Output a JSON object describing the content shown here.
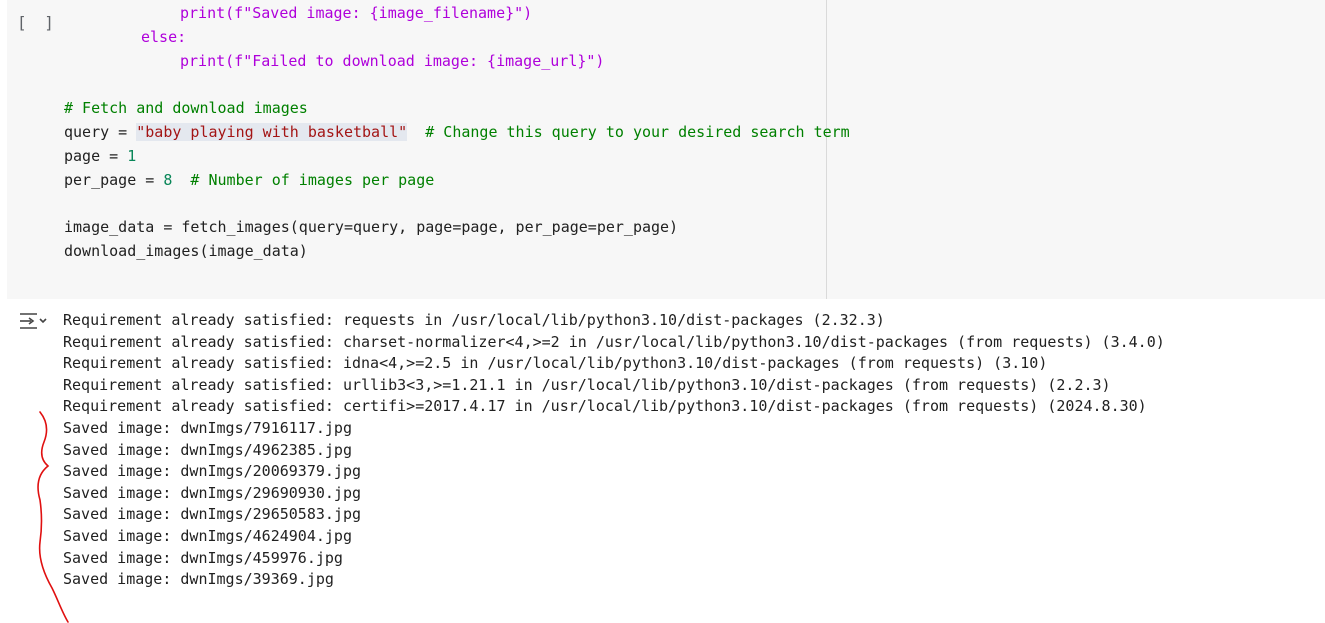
{
  "cell": {
    "run_indicator": "[ ]",
    "lines": {
      "l1": "print(f\"Saved image: {image_filename}\")",
      "l2": "else:",
      "l3": "print(f\"Failed to download image: {image_url}\")",
      "l4": "# Fetch and download images",
      "l5_a": "query = ",
      "l5_str": "\"baby playing with basketball\"",
      "l5_cmt": "  # Change this query to your desired search term",
      "l6_a": "page = ",
      "l6_num": "1",
      "l7_a": "per_page = ",
      "l7_num": "8",
      "l7_cmt": "  # Number of images per page",
      "l8": "image_data = fetch_images(query=query, page=page, per_page=per_page)",
      "l9": "download_images(image_data)"
    }
  },
  "output": {
    "icon": "output-toggle-icon",
    "lines": [
      "Requirement already satisfied: requests in /usr/local/lib/python3.10/dist-packages (2.32.3)",
      "Requirement already satisfied: charset-normalizer<4,>=2 in /usr/local/lib/python3.10/dist-packages (from requests) (3.4.0)",
      "Requirement already satisfied: idna<4,>=2.5 in /usr/local/lib/python3.10/dist-packages (from requests) (3.10)",
      "Requirement already satisfied: urllib3<3,>=1.21.1 in /usr/local/lib/python3.10/dist-packages (from requests) (2.2.3)",
      "Requirement already satisfied: certifi>=2017.4.17 in /usr/local/lib/python3.10/dist-packages (from requests) (2024.8.30)",
      "Saved image: dwnImgs/7916117.jpg",
      "Saved image: dwnImgs/4962385.jpg",
      "Saved image: dwnImgs/20069379.jpg",
      "Saved image: dwnImgs/29690930.jpg",
      "Saved image: dwnImgs/29650583.jpg",
      "Saved image: dwnImgs/4624904.jpg",
      "Saved image: dwnImgs/459976.jpg",
      "Saved image: dwnImgs/39369.jpg"
    ]
  },
  "colors": {
    "annotation_stroke": "#e01010",
    "keyword": "#af00db",
    "string": "#a31515",
    "comment": "#008000"
  }
}
